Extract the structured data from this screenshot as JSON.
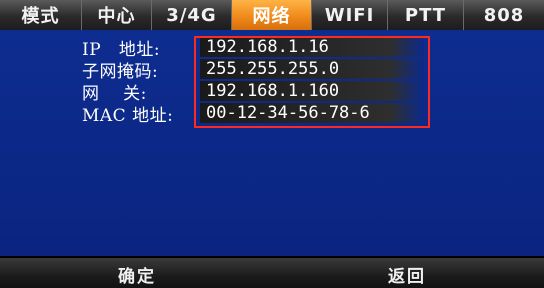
{
  "tabs": [
    {
      "label": "模式",
      "active": false
    },
    {
      "label": "中心",
      "active": false
    },
    {
      "label": "3/4G",
      "active": false
    },
    {
      "label": "网络",
      "active": true
    },
    {
      "label": "WIFI",
      "active": false
    },
    {
      "label": "PTT",
      "active": false
    },
    {
      "label": "808",
      "active": false
    }
  ],
  "network": {
    "ip_label": "IP   地址:",
    "ip_value": "192.168.1.16",
    "mask_label": "子网掩码:",
    "mask_value": "255.255.255.0",
    "gateway_label": "网    关:",
    "gateway_value": "192.168.1.160",
    "mac_label": "MAC 地址:",
    "mac_value": "00-12-34-56-78-6"
  },
  "softkeys": {
    "confirm": "确定",
    "back": "返回"
  },
  "colors": {
    "active_tab": "#f08a1c",
    "panel_bg": "#0d2a8a",
    "highlight_box": "#ff2a1e"
  }
}
